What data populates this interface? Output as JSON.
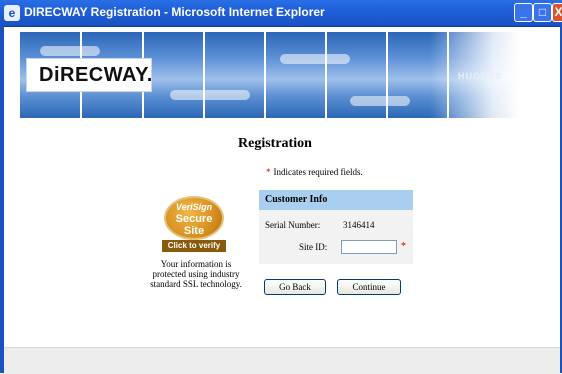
{
  "window": {
    "title": "DIRECWAY Registration - Microsoft Internet Explorer",
    "controls": {
      "minimize": "_",
      "maximize": "□",
      "close": "X"
    }
  },
  "banner": {
    "logo_text": "DiRECWAY.",
    "partner_text": "HUGHES"
  },
  "page": {
    "heading": "Registration",
    "required_note": "Indicates required fields.",
    "required_marker": "*"
  },
  "verisign": {
    "brand": "VeriSign",
    "line1": "Secure",
    "line2": "Site",
    "verify_label": "Click to verify"
  },
  "security_text": "Your information is protected using industry standard SSL technology.",
  "customer_info": {
    "header": "Customer Info",
    "serial_label": "Serial Number:",
    "serial_value": "3146414",
    "site_id_label": "Site ID:",
    "site_id_value": "",
    "site_id_required": "*"
  },
  "buttons": {
    "go_back": "Go Back",
    "continue": "Continue"
  },
  "colors": {
    "titlebar": "#1f5fd8",
    "info_header": "#a9cff0",
    "required_star": "#cc0000"
  }
}
